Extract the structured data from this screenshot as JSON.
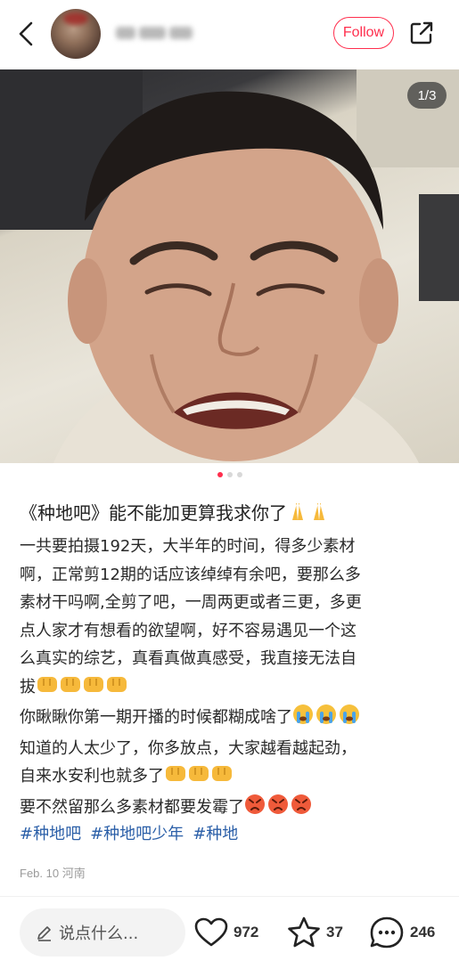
{
  "header": {
    "follow_label": "Follow",
    "icons": {
      "back": "chevron-left-icon",
      "share": "share-icon"
    }
  },
  "image": {
    "counter": "1/3"
  },
  "post": {
    "title": "《种地吧》能不能加更算我求你了",
    "body_lines": [
      "一共要拍摄192天，大半年的时间，得多少素材",
      "啊，正常剪12期的话应该绰绰有余吧，要那么多",
      "素材干吗啊,全剪了吧，一周两更或者三更，多更",
      "点人家才有想看的欲望啊，好不容易遇见一个这",
      "么真实的综艺，真看真做真感受，我直接无法自",
      "拔",
      "你瞅瞅你第一期开播的时候都糊成啥了",
      "知道的人太少了，你多放点，大家越看越起劲，",
      "自来水安利也就多了",
      "要不然留那么多素材都要发霉了"
    ],
    "tags": [
      "#种地吧",
      "#种地吧少年",
      "#种地"
    ],
    "meta": "Feb. 10 河南"
  },
  "bottom": {
    "comment_placeholder": "说点什么...",
    "likes": "972",
    "stars": "37",
    "comments": "246"
  },
  "colors": {
    "accent": "#ff2e4d",
    "tag": "#2b5fa8"
  }
}
